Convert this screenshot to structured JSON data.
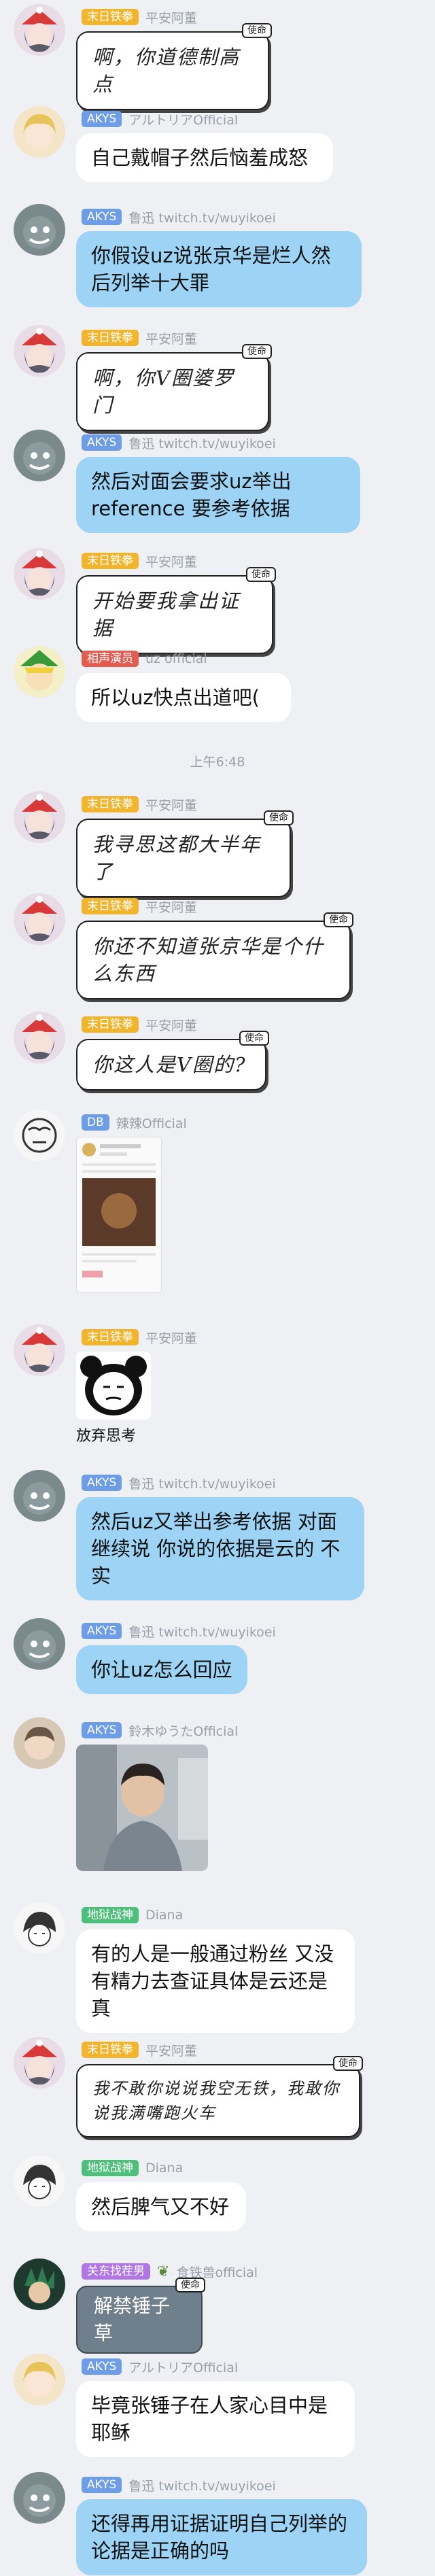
{
  "colors": {
    "badge_yellow": "#f2b42a",
    "badge_blue": "#6d9de6",
    "badge_red": "#e45b50",
    "badge_green": "#4cbf7a",
    "badge_purple": "#b076e6",
    "bubble_white": "#ffffff",
    "bubble_blue": "#9dd3f5"
  },
  "messages": [
    {
      "badge": "末日铁拳",
      "name": "平安阿董",
      "text": "啊，你道德制高点",
      "stamp": "使命"
    },
    {
      "badge": "AKYS",
      "name": "アルトリアOfficial",
      "text": "自己戴帽子然后恼羞成怒"
    },
    {
      "badge": "AKYS",
      "name": "鲁迅 twitch.tv/wuyikoei",
      "text": "你假设uz说张京华是烂人然后列举十大罪"
    },
    {
      "badge": "末日铁拳",
      "name": "平安阿董",
      "text": "啊，你V圈婆罗门",
      "stamp": "使命"
    },
    {
      "badge": "AKYS",
      "name": "鲁迅 twitch.tv/wuyikoei",
      "text": "然后对面会要求uz举出reference 要参考依据"
    },
    {
      "badge": "末日铁拳",
      "name": "平安阿董",
      "text": "开始要我拿出证据",
      "stamp": "使命"
    },
    {
      "badge": "相声演员",
      "name": "uz official",
      "text": "所以uz快点出道吧("
    },
    {
      "time": "上午6:48"
    },
    {
      "badge": "末日铁拳",
      "name": "平安阿董",
      "text": "我寻思这都大半年了",
      "stamp": "使命"
    },
    {
      "badge": "末日铁拳",
      "name": "平安阿董",
      "text": "你还不知道张京华是个什么东西",
      "stamp": "使命"
    },
    {
      "badge": "末日铁拳",
      "name": "平安阿董",
      "text": "你这人是V圈的?",
      "stamp": "使命"
    },
    {
      "badge": "DB",
      "name": "辣辣Official"
    },
    {
      "badge": "末日铁拳",
      "name": "平安阿董",
      "caption": "放弃思考"
    },
    {
      "badge": "AKYS",
      "name": "鲁迅 twitch.tv/wuyikoei",
      "text": "然后uz又举出参考依据 对面继续说 你说的依据是云的 不实"
    },
    {
      "badge": "AKYS",
      "name": "鲁迅 twitch.tv/wuyikoei",
      "text": "你让uz怎么回应"
    },
    {
      "badge": "AKYS",
      "name": "鈴木ゆうたOfficial"
    },
    {
      "badge": "地狱战神",
      "name": "Diana",
      "text": "有的人是一般通过粉丝 又没有精力去查证具体是云还是真"
    },
    {
      "badge": "末日铁拳",
      "name": "平安阿董",
      "text": "我不敢你说说我空无铁，我敢你说我满嘴跑火车",
      "stamp": "使命"
    },
    {
      "badge": "地狱战神",
      "name": "Diana",
      "text": "然后脾气又不好"
    },
    {
      "badge": "关东找茬男",
      "name": "食铁兽official",
      "text": "解禁锤子草",
      "stamp": "使命"
    },
    {
      "badge": "AKYS",
      "name": "アルトリアOfficial",
      "text": "毕竟张锤子在人家心目中是耶稣"
    },
    {
      "badge": "AKYS",
      "name": "鲁迅 twitch.tv/wuyikoei",
      "text": "还得再用证据证明自己列举的论据是正确的吗"
    }
  ]
}
